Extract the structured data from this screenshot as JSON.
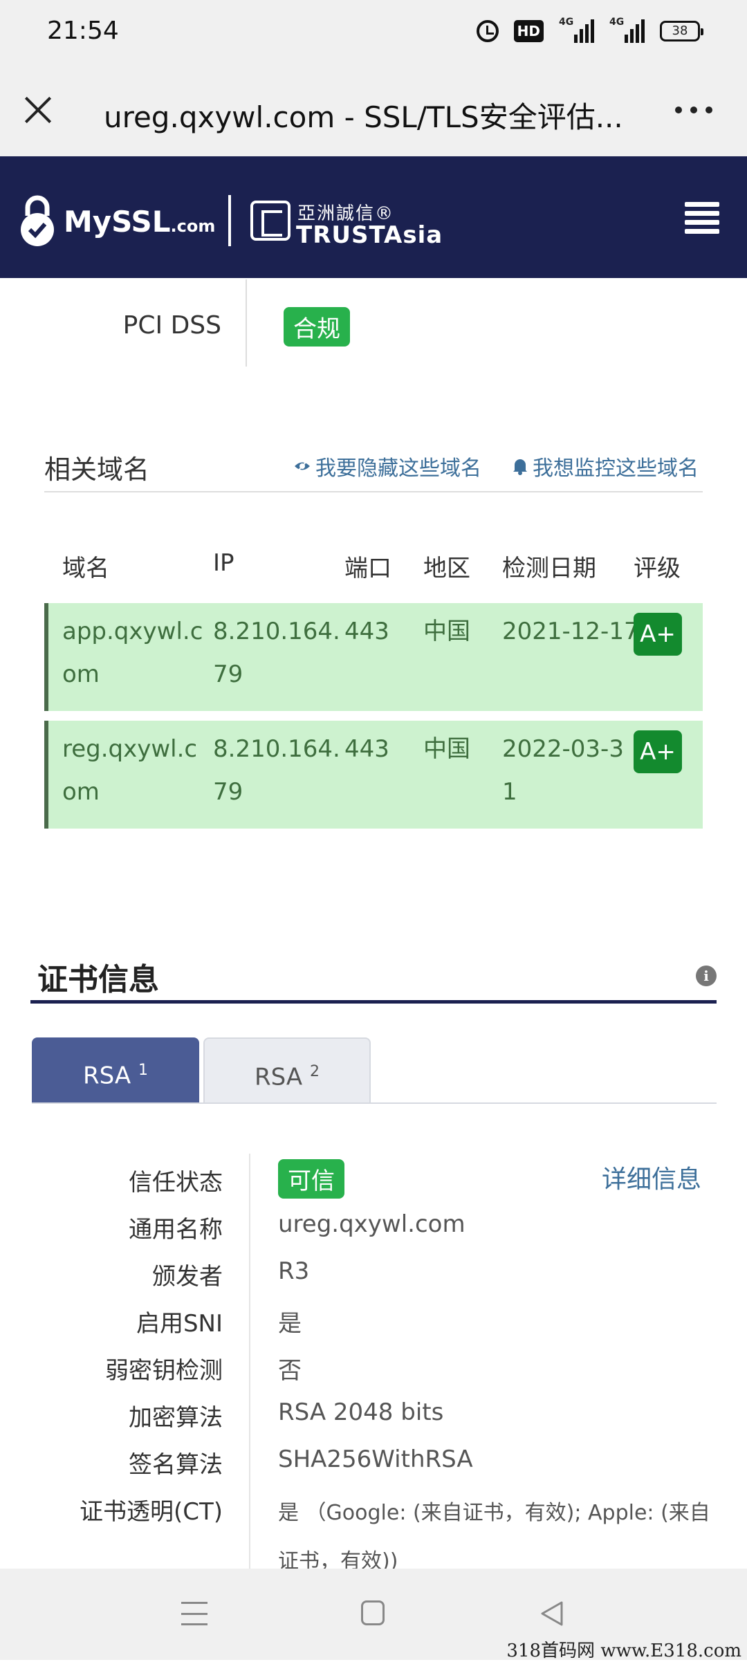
{
  "status_bar": {
    "time": "21:54",
    "hd_label": "HD",
    "net1": "4G",
    "net2": "4G",
    "battery": "38"
  },
  "browser": {
    "title": "ureg.qxywl.com - SSL/TLS安全评估..."
  },
  "header": {
    "myssl_main": "MySSL",
    "myssl_com": ".com",
    "trust_cn": "亞洲誠信®",
    "trust_en": "TRUSTAsia"
  },
  "pci": {
    "label": "PCI DSS",
    "status": "合规"
  },
  "related": {
    "title": "相关域名",
    "hide_action": "我要隐藏这些域名",
    "monitor_action": "我想监控这些域名",
    "columns": [
      "域名",
      "IP",
      "端口",
      "地区",
      "检测日期",
      "评级"
    ],
    "rows": [
      {
        "domain": [
          "app.qxywl.c",
          "om"
        ],
        "ip": [
          "8.210.164.",
          "79"
        ],
        "port": "443",
        "region": "中国",
        "date": [
          "2021-12-17",
          ""
        ],
        "grade": "A+"
      },
      {
        "domain": [
          "reg.qxywl.c",
          "om"
        ],
        "ip": [
          "8.210.164.",
          "79"
        ],
        "port": "443",
        "region": "中国",
        "date": [
          "2022-03-3",
          "1"
        ],
        "grade": "A+"
      }
    ]
  },
  "cert": {
    "title": "证书信息",
    "tabs": [
      {
        "label": "RSA",
        "sup": "1"
      },
      {
        "label": "RSA",
        "sup": "2"
      }
    ],
    "detail_link": "详细信息",
    "fields": [
      {
        "label": "信任状态",
        "value": "可信"
      },
      {
        "label": "通用名称",
        "value": "ureg.qxywl.com"
      },
      {
        "label": "颁发者",
        "value": "R3"
      },
      {
        "label": "启用SNI",
        "value": "是"
      },
      {
        "label": "弱密钥检测",
        "value": "否"
      },
      {
        "label": "加密算法",
        "value": "RSA 2048 bits"
      },
      {
        "label": "签名算法",
        "value": "SHA256WithRSA"
      },
      {
        "label": "证书透明(CT)",
        "value": "是 （Google: (来自证书，有效); Apple: (来自",
        "value_line2": "证书，有效))"
      }
    ]
  },
  "watermark": "318首码网 www.E318.com",
  "colors": {
    "header_bg": "#1b2150",
    "badge_green": "#28b14c",
    "row_green": "#cdf2cf",
    "grade_green": "#138a2e",
    "tab_active": "#4b5c95",
    "link_blue": "#3d6f9a"
  }
}
